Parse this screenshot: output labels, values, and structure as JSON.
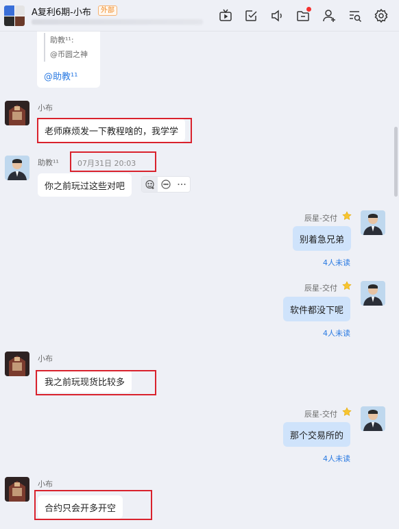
{
  "header": {
    "title": "A复利6期-小布",
    "external_badge": "外部",
    "toolbar_icons": [
      "tv-icon",
      "checkbox-icon",
      "volume-icon",
      "folder-icon",
      "add-user-icon",
      "search-list-icon",
      "gear-icon"
    ]
  },
  "quote": {
    "author": "助教¹¹:",
    "text": "@币圆之神",
    "mention": "@助教¹¹"
  },
  "messages": [
    {
      "sender": "小布",
      "text": "老师麻烦发一下教程啥的，我学学"
    },
    {
      "sender": "助教¹¹",
      "time": "07月31日 20:03",
      "text": "你之前玩过这些对吧"
    },
    {
      "sender": "辰星-交付",
      "text": "别着急兄弟",
      "unread": "4人未读"
    },
    {
      "sender": "辰星-交付",
      "text": "软件都没下呢",
      "unread": "4人未读"
    },
    {
      "sender": "小布",
      "text": "我之前玩现货比较多"
    },
    {
      "sender": "辰星-交付",
      "text": "那个交易所的",
      "unread": "4人未读"
    },
    {
      "sender": "小布",
      "text": "合约只会开多开空"
    }
  ],
  "message_actions": [
    "emoji-reaction-icon",
    "reply-icon",
    "more-icon"
  ],
  "colors": {
    "background": "#eef0f6",
    "my_bubble": "#cfe3fb",
    "highlight_box": "#d9212c",
    "unread_link": "#2a7ae2",
    "external_badge": "#f08a24"
  }
}
